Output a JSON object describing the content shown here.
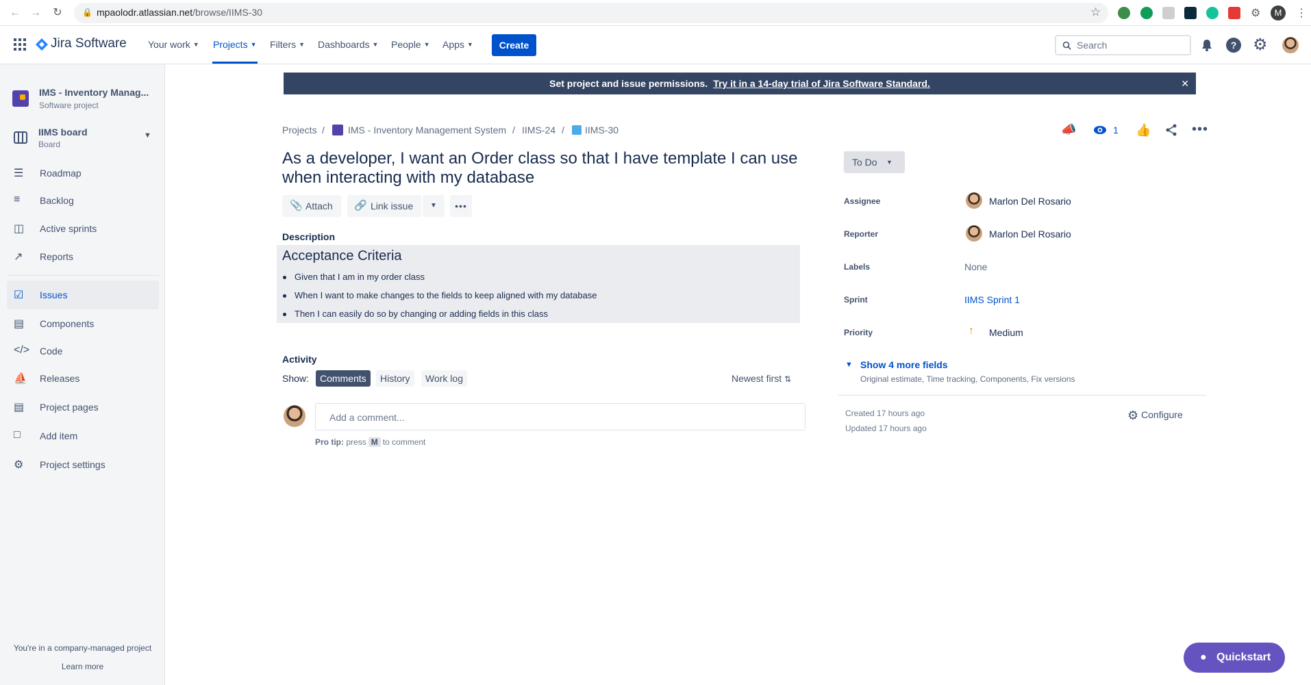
{
  "browser": {
    "url_host": "mpaolodr.atlassian.net",
    "url_path": "/browse/IIMS-30"
  },
  "topnav": {
    "product": "Jira Software",
    "items": [
      {
        "label": "Your work"
      },
      {
        "label": "Projects"
      },
      {
        "label": "Filters"
      },
      {
        "label": "Dashboards"
      },
      {
        "label": "People"
      },
      {
        "label": "Apps"
      }
    ],
    "create_label": "Create",
    "search_placeholder": "Search",
    "account_initial": "M"
  },
  "sidebar": {
    "project_name": "IMS - Inventory Manag...",
    "project_type": "Software project",
    "board_name": "IIMS board",
    "board_sub": "Board",
    "items": [
      {
        "label": "Roadmap"
      },
      {
        "label": "Backlog"
      },
      {
        "label": "Active sprints"
      },
      {
        "label": "Reports"
      },
      {
        "label": "Issues"
      },
      {
        "label": "Components"
      },
      {
        "label": "Code"
      },
      {
        "label": "Releases"
      },
      {
        "label": "Project pages"
      },
      {
        "label": "Add item"
      },
      {
        "label": "Project settings"
      }
    ],
    "footer_text": "You're in a company-managed project",
    "footer_link": "Learn more"
  },
  "banner": {
    "text": "Set project and issue permissions.",
    "link": "Try it in a 14-day trial of Jira Software Standard."
  },
  "breadcrumb": {
    "projects": "Projects",
    "project": "IMS - Inventory Management System",
    "parent": "IIMS-24",
    "issue": "IIMS-30",
    "separator": "/"
  },
  "issue": {
    "title": "As a developer, I want an Order class so that I have template I can use when interacting with my database",
    "attach_label": "Attach",
    "link_issue_label": "Link issue",
    "watch_count": "1",
    "description_label": "Description",
    "ac_heading": "Acceptance Criteria",
    "ac_items": [
      "Given that I am in my order class",
      "When I want to make changes to the fields to keep aligned with my database",
      "Then I can easily do so by changing or adding fields in this class"
    ]
  },
  "activity": {
    "label": "Activity",
    "show_label": "Show:",
    "tabs": [
      "Comments",
      "History",
      "Work log"
    ],
    "sort_label": "Newest first",
    "comment_placeholder": "Add a comment...",
    "pro_tip_label": "Pro tip:",
    "pro_tip_press": "press",
    "pro_tip_key": "M",
    "pro_tip_after": "to comment"
  },
  "details": {
    "status": "To Do",
    "fields": [
      {
        "label": "Assignee",
        "value": "Marlon Del Rosario"
      },
      {
        "label": "Reporter",
        "value": "Marlon Del Rosario"
      },
      {
        "label": "Labels",
        "value": "None"
      },
      {
        "label": "Sprint",
        "value": "IIMS Sprint 1"
      },
      {
        "label": "Priority",
        "value": "Medium"
      }
    ],
    "more_fields": "Show 4 more fields",
    "more_fields_sub": "Original estimate, Time tracking, Components, Fix versions",
    "created": "Created 17 hours ago",
    "updated": "Updated 17 hours ago",
    "configure_label": "Configure"
  },
  "quickstart_label": "Quickstart",
  "colors": {
    "brand": "#0052CC",
    "banner_bg": "#344563",
    "quickstart_bg": "#6554C0",
    "priority_medium": "#FF8B00"
  }
}
